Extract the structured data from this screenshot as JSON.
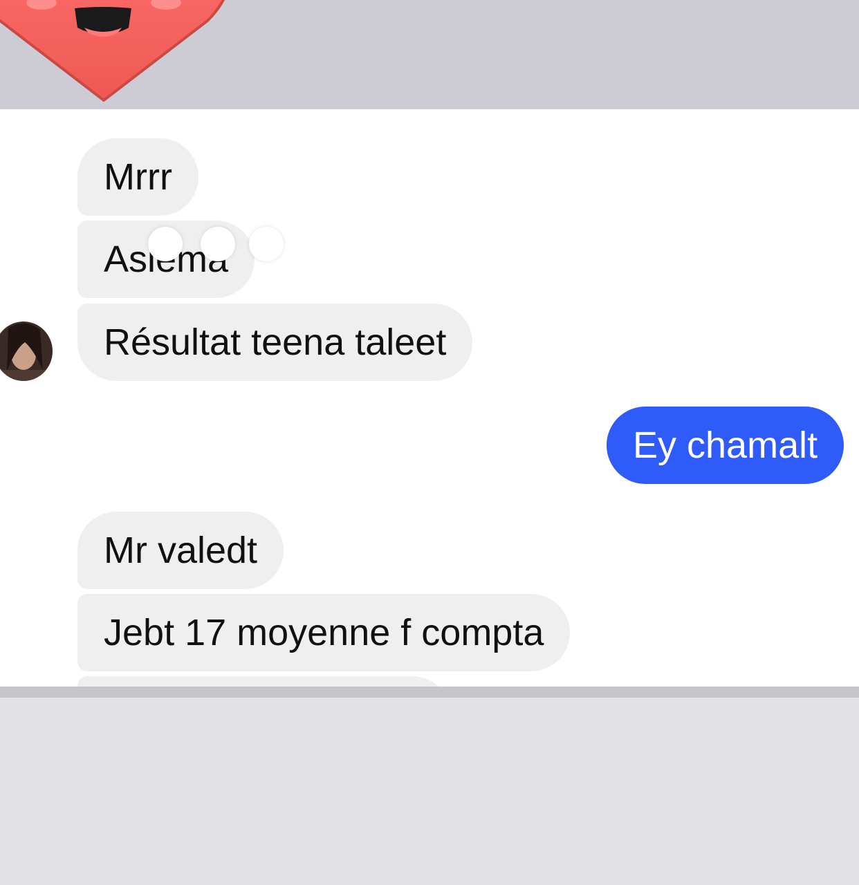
{
  "thread": {
    "incoming_group_1": [
      "Mrrr",
      "Asiema",
      "Résultat teena taleet"
    ],
    "outgoing": [
      "Ey chamalt"
    ],
    "incoming_group_2": [
      "Mr valedt",
      "Jebt 17 moyenne f compta"
    ]
  },
  "colors": {
    "incoming_bubble": "#efefef",
    "outgoing_bubble": "#2f5bfa",
    "heart_sticker": "#f2645f"
  },
  "icons": {
    "sticker": "heart-face-sticker-icon",
    "typing": "typing-indicator-icon",
    "avatar": "contact-avatar"
  }
}
